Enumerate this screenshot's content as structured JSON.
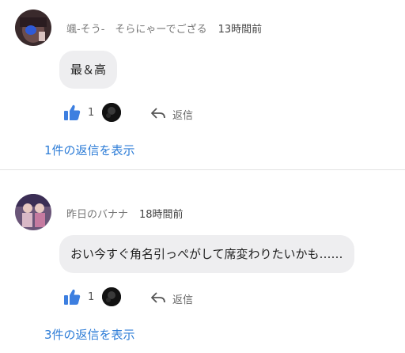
{
  "comments": [
    {
      "author": "颯-そう-　そらにゃーでござる",
      "time": "13時間前",
      "text": "最＆高",
      "like_count": "1",
      "reply_label": "返信",
      "view_replies": "1件の返信を表示"
    },
    {
      "author": "昨日のバナナ",
      "time": "18時間前",
      "text": "おい今すぐ角名引っぺがして席変わりたいかも……",
      "like_count": "1",
      "reply_label": "返信",
      "view_replies": "3件の返信を表示"
    }
  ],
  "colors": {
    "like": "#3d7fe0",
    "link": "#2e7dd7",
    "bubble": "#eeeef0"
  },
  "icons": {
    "like": "thumbs-up-icon",
    "reply": "reply-arrow-icon"
  }
}
